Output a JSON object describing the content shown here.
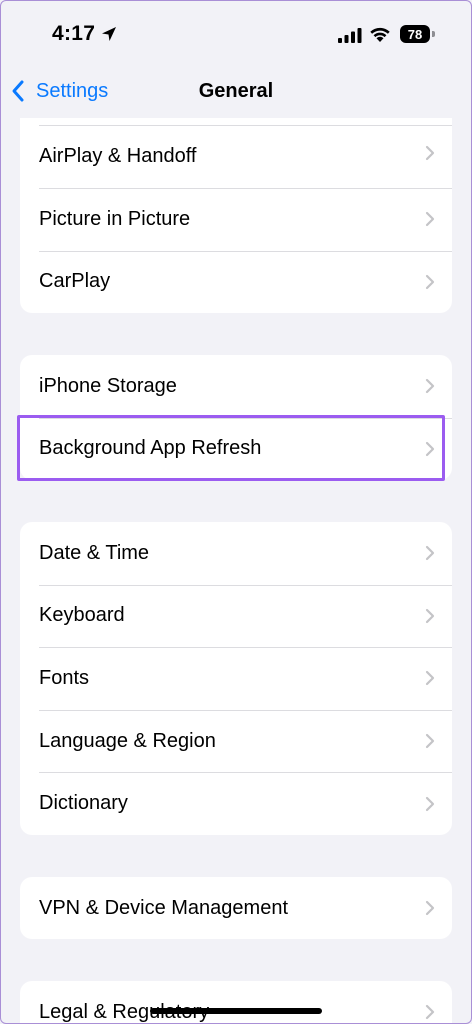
{
  "status_bar": {
    "time": "4:17",
    "battery": "78"
  },
  "nav": {
    "back_label": "Settings",
    "title": "General"
  },
  "groups": [
    {
      "items": [
        {
          "label": "AirPlay & Handoff"
        },
        {
          "label": "Picture in Picture"
        },
        {
          "label": "CarPlay"
        }
      ]
    },
    {
      "items": [
        {
          "label": "iPhone Storage"
        },
        {
          "label": "Background App Refresh"
        }
      ]
    },
    {
      "items": [
        {
          "label": "Date & Time"
        },
        {
          "label": "Keyboard"
        },
        {
          "label": "Fonts"
        },
        {
          "label": "Language & Region"
        },
        {
          "label": "Dictionary"
        }
      ]
    },
    {
      "items": [
        {
          "label": "VPN & Device Management"
        }
      ]
    },
    {
      "items": [
        {
          "label": "Legal & Regulatory"
        }
      ]
    }
  ],
  "colors": {
    "accent": "#0a7aff",
    "highlight": "#9b5cf0",
    "background": "#f2f2f7"
  }
}
